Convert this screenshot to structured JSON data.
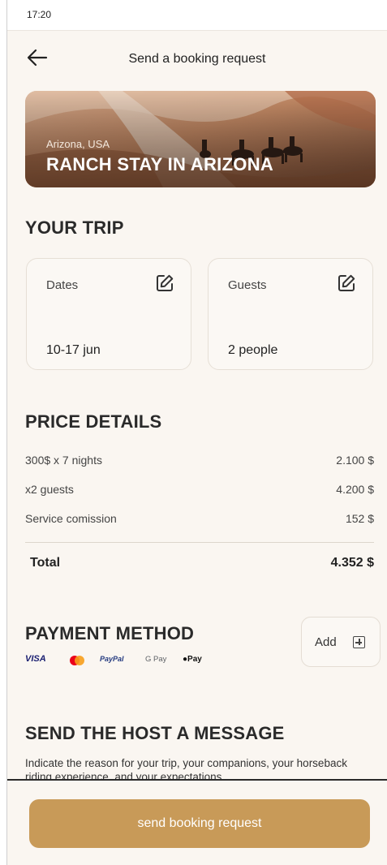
{
  "status": {
    "time": "17:20"
  },
  "header": {
    "title": "Send a booking request"
  },
  "hero": {
    "location": "Arizona, USA",
    "title": "RANCH STAY IN ARIZONA"
  },
  "trip": {
    "heading": "YOUR TRIP",
    "dates": {
      "label": "Dates",
      "value": "10-17 jun"
    },
    "guests": {
      "label": "Guests",
      "value": "2 people"
    }
  },
  "price": {
    "heading": "PRICE DETAILS",
    "rows": [
      {
        "label": "300$ x 7 nights",
        "value": "2.100 $"
      },
      {
        "label": "x2 guests",
        "value": "4.200 $"
      },
      {
        "label": "Service comission",
        "value": "152 $"
      }
    ],
    "total_label": "Total",
    "total_value": "4.352 $"
  },
  "payment": {
    "heading": "PAYMENT METHOD",
    "methods": [
      "VISA",
      "Mastercard",
      "PayPal",
      "G Pay",
      "Pay"
    ],
    "add_label": "Add"
  },
  "message": {
    "heading": "SEND THE HOST A MESSAGE",
    "text": "Indicate the reason for your trip, your companions, your horseback riding experience, and your expectations"
  },
  "cta": {
    "label": "send booking request"
  },
  "colors": {
    "accent": "#c89a58",
    "background": "#faf6f1"
  }
}
